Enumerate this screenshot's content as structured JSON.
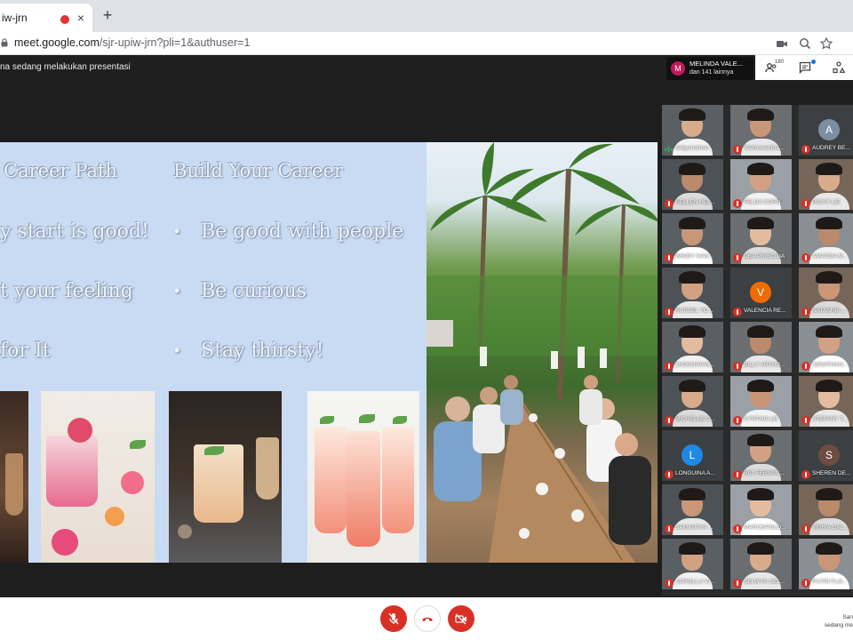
{
  "browser": {
    "tab_title": "iw-jrn",
    "tab_close": "×",
    "new_tab": "+",
    "url_host": "meet.google.com",
    "url_path": "/sjr-upiw-jrn?pli=1&authuser=1"
  },
  "meet": {
    "presenting_text": "na sedang melakukan presentasi",
    "pinned_initial": "M",
    "pinned_name": "MELINDA VALE...",
    "pinned_sub": "dan 141 lainnya",
    "people_count": "180",
    "bottom_note_line1": "San",
    "bottom_note_line2": "sedang me"
  },
  "slide": {
    "left_title": "Career Path",
    "left_items": [
      "y start is good!",
      "t your feeling",
      "for It"
    ],
    "right_title": "Build Your Career",
    "right_items": [
      "Be good with people",
      "Be curious",
      "Stay thirsty!"
    ],
    "bullet": "•"
  },
  "participants": [
    {
      "name": "raldyonathan",
      "speaking": true
    },
    {
      "name": "Vishnuvardha..."
    },
    {
      "name": "AUDREY BE...",
      "initial": "A",
      "color": "#7b8fa3"
    },
    {
      "name": "HELLEN HEL..."
    },
    {
      "name": "FELDA CORN..."
    },
    {
      "name": "RICKY LIE"
    },
    {
      "name": "WINDY IVAN..."
    },
    {
      "name": "DEA PRISCILIA"
    },
    {
      "name": "AMANDA M..."
    },
    {
      "name": "RUSSEL YO..."
    },
    {
      "name": "VALENCIA RE...",
      "initial": "V",
      "color": "#ef6c00"
    },
    {
      "name": "NATASHIA ..."
    },
    {
      "name": "JHONNATAN..."
    },
    {
      "name": "BILLY ARTHU..."
    },
    {
      "name": "JONATHAN..."
    },
    {
      "name": "MICHELLE C..."
    },
    {
      "name": "CYNTHIA LE..."
    },
    {
      "name": "STEFANY T..."
    },
    {
      "name": "LONGUINA A...",
      "initial": "L",
      "color": "#1e88e5"
    },
    {
      "name": "RIO FERNAN..."
    },
    {
      "name": "SHEREN DE...",
      "initial": "S",
      "color": "#6d4c41"
    },
    {
      "name": "SAMANTHA ..."
    },
    {
      "name": "MARCOPOLO..."
    },
    {
      "name": "VIRIYA GAL..."
    },
    {
      "name": "ADRIELLA VI..."
    },
    {
      "name": "SELWYN SEL..."
    },
    {
      "name": "PUTRI FLO..."
    }
  ],
  "colors": {
    "mute_red": "#d93025",
    "slide_bg": "#c9dbf2",
    "accent_blue": "#1a73e8"
  }
}
